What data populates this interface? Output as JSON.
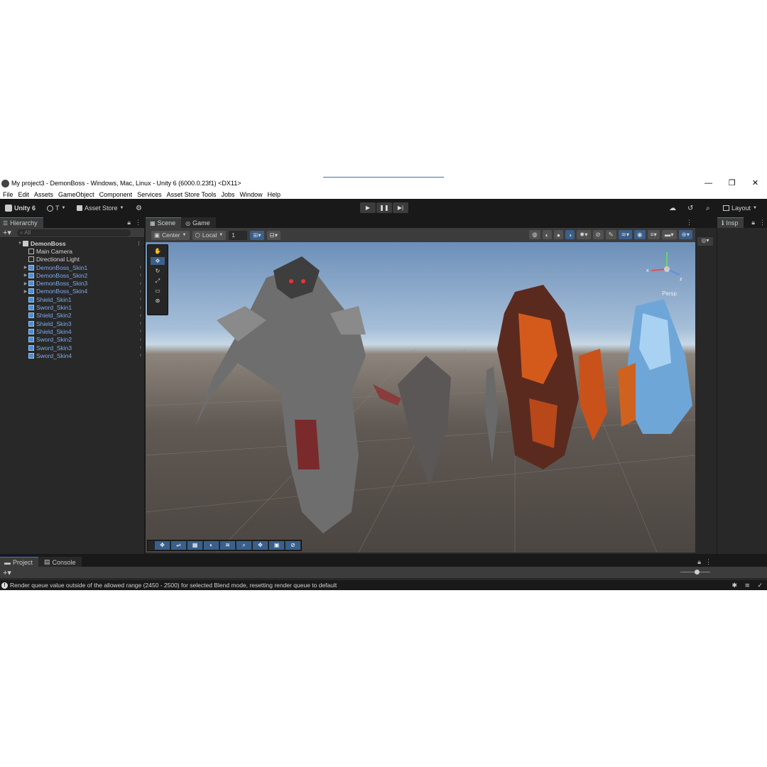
{
  "window": {
    "title": "My project3 - DemonBoss - Windows, Mac, Linux - Unity 6 (6000.0.23f1) <DX11>",
    "controls": [
      "—",
      "❐",
      "✕"
    ]
  },
  "menu": [
    "File",
    "Edit",
    "Assets",
    "GameObject",
    "Component",
    "Services",
    "Asset Store Tools",
    "Jobs",
    "Window",
    "Help"
  ],
  "toolbar": {
    "brand": "Unity 6",
    "account": "T",
    "asset_store": "Asset Store",
    "layout": "Layout"
  },
  "hierarchy": {
    "tab": "Hierarchy",
    "search_placeholder": "All",
    "scene_name": "DemonBoss",
    "items": [
      {
        "label": "Main Camera",
        "prefab": false,
        "expandable": false
      },
      {
        "label": "Directional Light",
        "prefab": false,
        "expandable": false
      },
      {
        "label": "DemonBoss_Skin1",
        "prefab": true,
        "expandable": true
      },
      {
        "label": "DemonBoss_Skin2",
        "prefab": true,
        "expandable": true
      },
      {
        "label": "DemonBoss_Skin3",
        "prefab": true,
        "expandable": true
      },
      {
        "label": "DemonBoss_Skin4",
        "prefab": true,
        "expandable": true
      },
      {
        "label": "Shield_Skin1",
        "prefab": true,
        "expandable": false
      },
      {
        "label": "Sword_Skin1",
        "prefab": true,
        "expandable": false
      },
      {
        "label": "Shield_Skin2",
        "prefab": true,
        "expandable": false
      },
      {
        "label": "Shield_Skin3",
        "prefab": true,
        "expandable": false
      },
      {
        "label": "Shield_Skin4",
        "prefab": true,
        "expandable": false
      },
      {
        "label": "Sword_Skin2",
        "prefab": true,
        "expandable": false
      },
      {
        "label": "Sword_Skin3",
        "prefab": true,
        "expandable": false
      },
      {
        "label": "Sword_Skin4",
        "prefab": true,
        "expandable": false
      }
    ]
  },
  "scene": {
    "tabs": [
      {
        "label": "Scene",
        "active": true
      },
      {
        "label": "Game",
        "active": false
      }
    ],
    "pivot": "Center",
    "space": "Local",
    "snap_value": "1",
    "view_label": "Persp"
  },
  "inspector": {
    "tab": "Insp"
  },
  "bottom": {
    "tabs": [
      "Project",
      "Console"
    ]
  },
  "status": {
    "message": "Render queue value outside of the allowed range (2450 - 2500) for selected Blend mode, resetting render queue to default"
  },
  "colors": {
    "accent": "#3a79bb",
    "prefab_text": "#7fa9e8",
    "panel": "#282828",
    "dark": "#191919"
  }
}
